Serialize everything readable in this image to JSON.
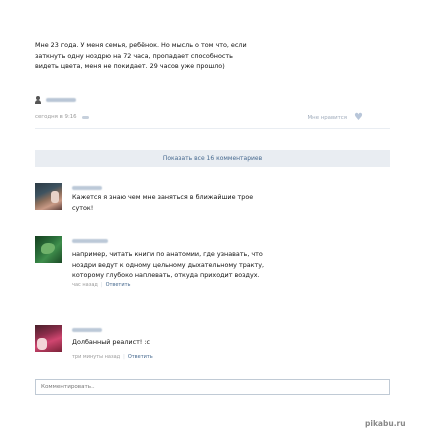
{
  "post": {
    "text_lines": [
      "Мне 23 года. У меня семья, ребёнок. Но мысль о том что, если",
      "заткнуть одну ноздрю на 72 часа, пропадает способность",
      "видеть цвета, меня не покидает. 29 часов уже прошло)"
    ],
    "date": "сегодня в 9:16",
    "likes_label": "Мне нравится"
  },
  "show_all_comments": "Показать все 16 комментариев",
  "comments": [
    {
      "text_lines": [
        "Кажется я знаю чем мне заняться в ближайшие трое",
        "суток!"
      ]
    },
    {
      "text_lines": [
        "например, читать книги по анатомии, где узнавать, что",
        "ноздри ведут к одному цельному дыхательному тракту,",
        "которому глубоко наплевать, откуда приходит воздух."
      ],
      "time": "час назад",
      "reply": "Ответить"
    },
    {
      "text_lines": [
        "Долбанный реалист! :c"
      ],
      "time": "три минуты назад",
      "reply": "Ответить"
    }
  ],
  "comment_input": {
    "placeholder": "Комментировать.."
  },
  "watermark": "pikabu.ru",
  "colors": {
    "link": "#45688e",
    "separator_bg": "#e9edf2",
    "meta_gray": "#9a9a9a"
  },
  "icons": [
    "person-icon",
    "heart-icon"
  ]
}
